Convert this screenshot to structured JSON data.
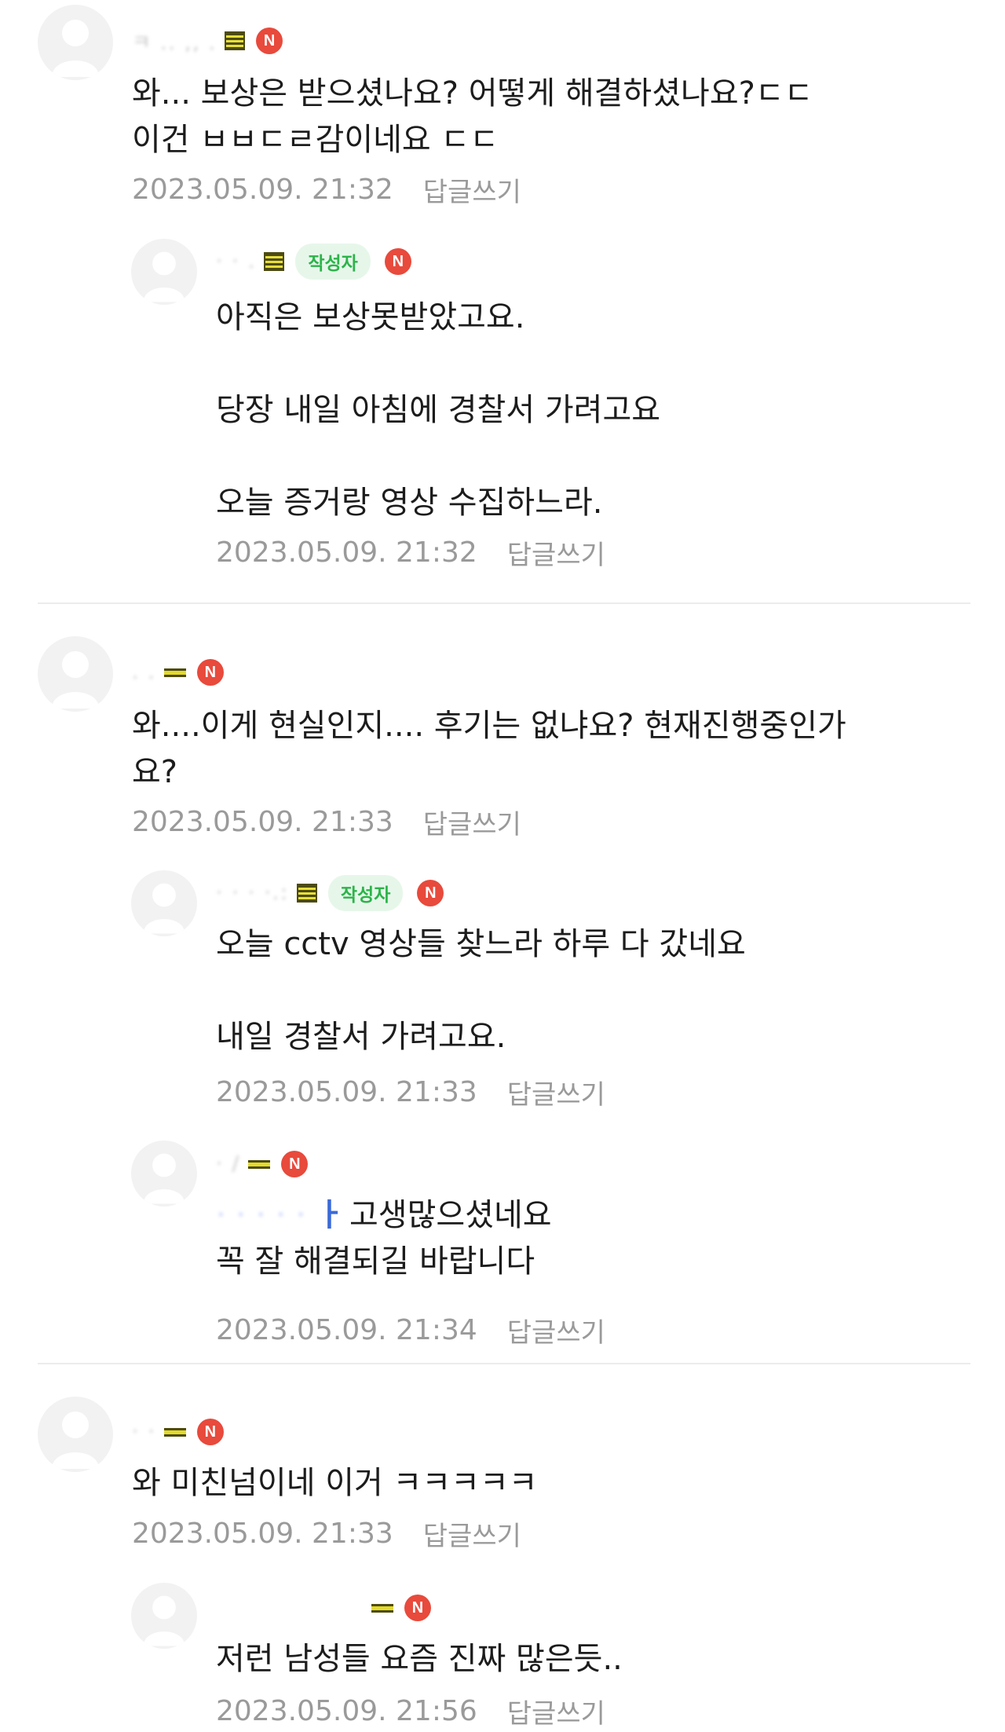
{
  "comments": [
    {
      "nickname": "ㅋ .. ,, .",
      "author_badge": "",
      "new_badge": "N",
      "body": "와... 보상은 받으셨나요? 어떻게 해결하셨나요?ㄷㄷ\n이건 ㅂㅂㄷㄹ감이네요 ㄷㄷ",
      "date": "2023.05.09. 21:32",
      "reply_link": "답글쓰기"
    },
    {
      "nickname": "· · .",
      "author_badge": "작성자",
      "new_badge": "N",
      "body": "아직은 보상못받았고요.\n\n당장 내일 아침에 경찰서 가려고요\n\n오늘 증거랑 영상 수집하느라.",
      "date": "2023.05.09. 21:32",
      "reply_link": "답글쓰기"
    },
    {
      "nickname": ". .",
      "author_badge": "",
      "new_badge": "N",
      "body": "와....이게 현실인지.... 후기는 없냐요? 현재진행중인가\n요?",
      "date": "2023.05.09. 21:33",
      "reply_link": "답글쓰기"
    },
    {
      "nickname": "· · · ·.:",
      "author_badge": "작성자",
      "new_badge": "N",
      "body": "오늘 cctv 영상들 찾느라 하루 다 갔네요\n\n내일 경찰서 가려고요.",
      "date": "2023.05.09. 21:33",
      "reply_link": "답글쓰기"
    },
    {
      "nickname": "· /",
      "author_badge": "",
      "new_badge": "N",
      "mention": "· · · · ·",
      "mention_mark": "ㅏ",
      "body": "고생많으셨네요\n꼭 잘 해결되길 바랍니다",
      "date": "2023.05.09. 21:34",
      "reply_link": "답글쓰기"
    },
    {
      "nickname": "· ·",
      "author_badge": "",
      "new_badge": "N",
      "body": "와 미친넘이네 이거 ㅋㅋㅋㅋㅋ",
      "date": "2023.05.09. 21:33",
      "reply_link": "답글쓰기"
    },
    {
      "nickname": "",
      "author_badge": "",
      "new_badge": "N",
      "body": "저런 남성들 요즘 진짜 많은듯..",
      "date": "2023.05.09. 21:56",
      "reply_link": "답글쓰기"
    }
  ],
  "icons": {
    "avatar": "default-profile-icon",
    "level": "member-level-icon",
    "new": "new-badge-icon"
  },
  "colors": {
    "author_badge_bg": "#e6f7ea",
    "author_badge_text": "#2db34a",
    "new_badge": "#e84a3c",
    "meta_text": "#9a9a9a"
  }
}
